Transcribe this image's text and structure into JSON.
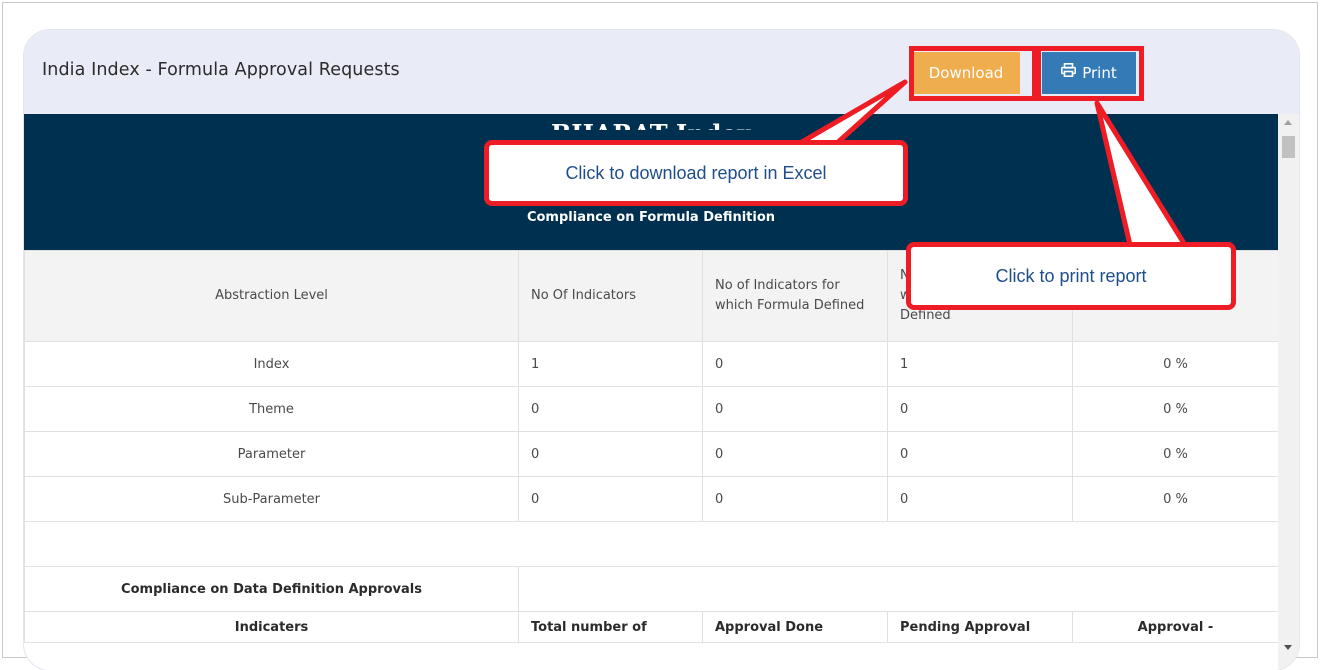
{
  "page": {
    "title": "India Index - Formula Approval Requests",
    "download_label": "Download",
    "print_label": "Print"
  },
  "banner": {
    "title": "BHARAT Index",
    "subtitle": "Compliance on Formula Definition"
  },
  "table": {
    "headers": [
      "Abstraction Level",
      "No Of Indicators",
      "No of Indicators for which Formula Defined",
      "No of Indicators for which Formula not Defined",
      ""
    ],
    "rows": [
      [
        "Index",
        "1",
        "0",
        "1",
        "0 %"
      ],
      [
        "Theme",
        "0",
        "0",
        "0",
        "0 %"
      ],
      [
        "Parameter",
        "0",
        "0",
        "0",
        "0 %"
      ],
      [
        "Sub-Parameter",
        "0",
        "0",
        "0",
        "0 %"
      ]
    ],
    "section2_title": "Compliance on Data Definition Approvals",
    "section2_headers": [
      "Indicaters",
      "Total number of",
      "Approval Done",
      "Pending Approval",
      "Approval -"
    ]
  },
  "callouts": {
    "download_hint": "Click to download  report in Excel",
    "print_hint": "Click to print report"
  },
  "colors": {
    "download_button": "#f0ad4e",
    "print_button": "#337ab7",
    "banner": "#00304f",
    "highlight": "#ee1c25",
    "callout_text": "#1f4e8c"
  }
}
